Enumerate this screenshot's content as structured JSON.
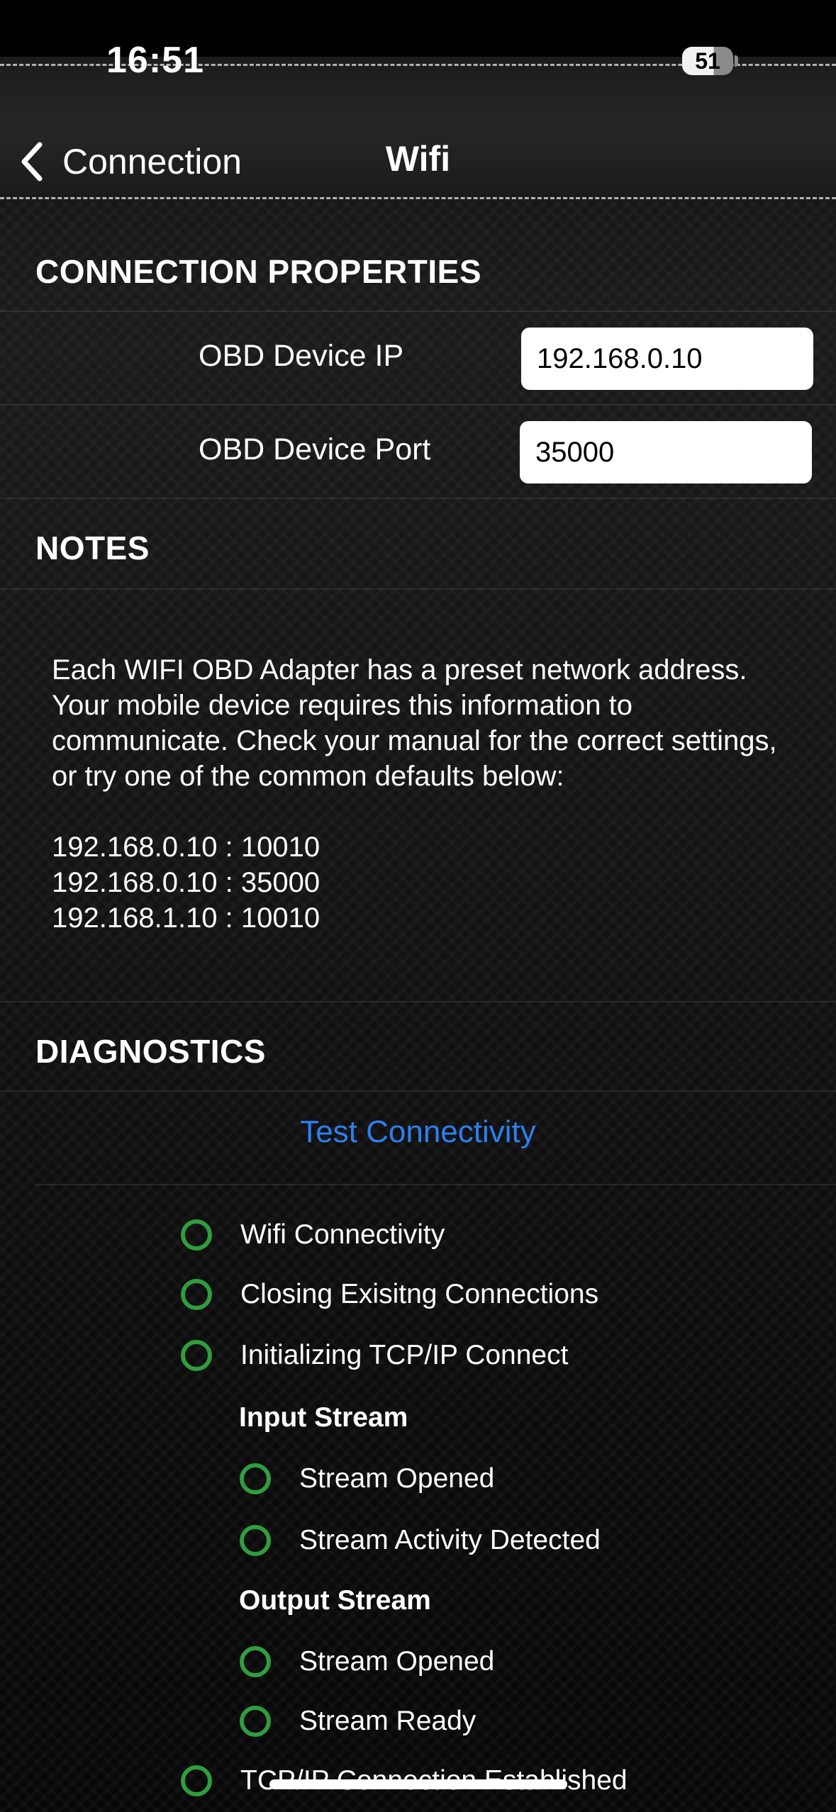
{
  "status_bar": {
    "time": "16:51",
    "battery_level": "51"
  },
  "nav": {
    "back_label": "Connection",
    "title": "Wifi"
  },
  "connection_properties": {
    "header": "CONNECTION PROPERTIES",
    "ip_label": "OBD Device IP",
    "ip_value": "192.168.0.10",
    "port_label": "OBD Device Port",
    "port_value": "35000"
  },
  "notes": {
    "header": "NOTES",
    "body": "Each WIFI OBD Adapter has a preset network address. Your mobile device requires this information to communicate. Check your manual for the correct settings, or try one of the common defaults below:\n\n192.168.0.10 : 10010\n192.168.0.10 : 35000\n192.168.1.10 : 10010"
  },
  "diagnostics": {
    "header": "DIAGNOSTICS",
    "test_button": "Test Connectivity",
    "items": [
      "Wifi Connectivity",
      "Closing Exisitng Connections",
      "Initializing TCP/IP Connect"
    ],
    "input_stream": {
      "header": "Input Stream",
      "items": [
        "Stream Opened",
        "Stream Activity Detected"
      ]
    },
    "output_stream": {
      "header": "Output Stream",
      "items": [
        "Stream Opened",
        "Stream Ready"
      ]
    },
    "final_item": "TCP/IP Connection Established",
    "status_color": "#2f9d3e"
  },
  "colors": {
    "accent": "#2d7ff0"
  }
}
